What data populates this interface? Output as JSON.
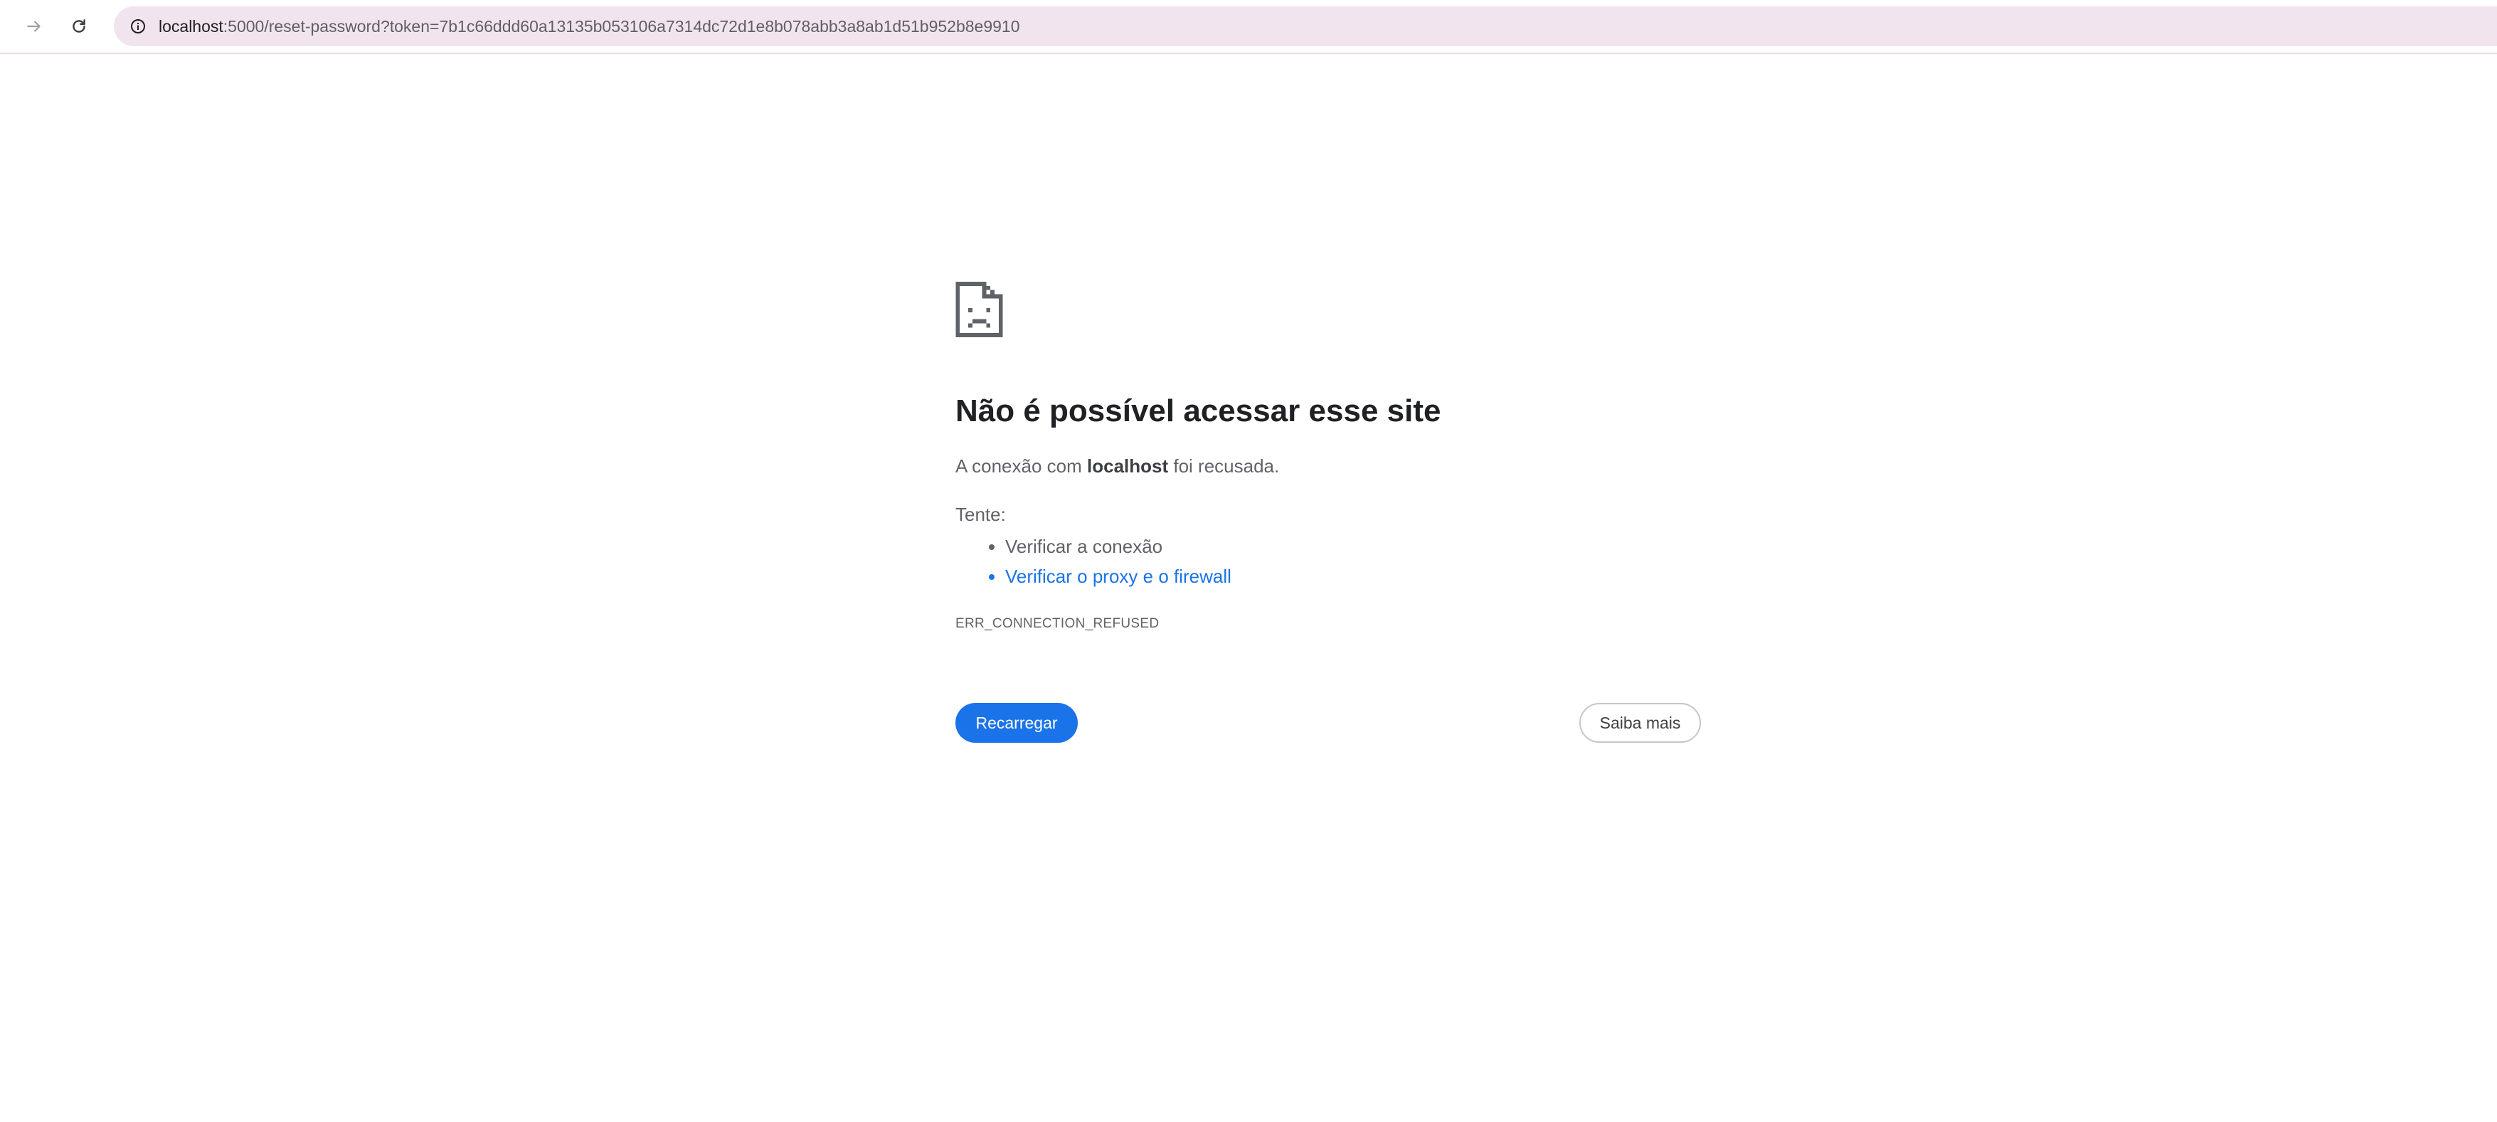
{
  "browser": {
    "url_host": "localhost",
    "url_rest": ":5000/reset-password?token=7b1c66ddd60a13135b053106a7314dc72d1e8b078abb3a8ab1d51b952b8e9910",
    "icons": {
      "forward": "arrow-right-icon",
      "reload": "reload-icon",
      "site_info": "info-icon"
    }
  },
  "error": {
    "icon": "sad-page-icon",
    "title": "Não é possível acessar esse site",
    "summary_prefix": "A conexão com ",
    "summary_host": "localhost",
    "summary_suffix": " foi recusada.",
    "try_label": "Tente:",
    "suggestions": [
      "Verificar a conexão",
      "Verificar o proxy e o firewall"
    ],
    "code": "ERR_CONNECTION_REFUSED"
  },
  "buttons": {
    "reload": "Recarregar",
    "learn_more": "Saiba mais"
  },
  "colors": {
    "accent": "#1a73e8",
    "omnibox_bg": "#f1e4ef",
    "text_primary": "#202124",
    "text_secondary": "#5f6368"
  }
}
